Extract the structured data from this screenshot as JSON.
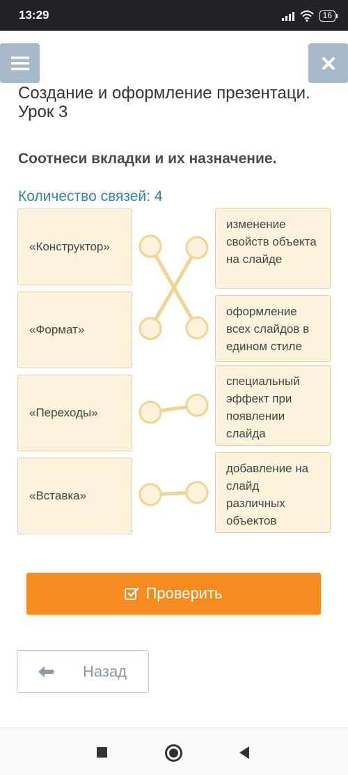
{
  "status": {
    "time": "13:29",
    "battery": "16"
  },
  "header": {
    "menu_icon": "hamburger-icon",
    "close_icon": "close-icon"
  },
  "lesson": {
    "title": "Создание и оформление презентаци. Урок 3"
  },
  "task": {
    "title": "Соотнеси вкладки и их назначение.",
    "links_count": "Количество связей: 4"
  },
  "matching": {
    "left": [
      "«Конструктор»",
      "«Формат»",
      "«Переходы»",
      "«Вставка»"
    ],
    "right": [
      "изменение свойств объекта на слайде",
      "оформление всех слайдов в едином стиле",
      "специальный эффект при появлении слайда",
      "добавление на слайд различных объектов"
    ],
    "links": [
      [
        0,
        1
      ],
      [
        1,
        0
      ],
      [
        2,
        2
      ],
      [
        3,
        3
      ]
    ],
    "connector_color": "#f0d58e"
  },
  "buttons": {
    "check_label": "Проверить",
    "back_label": "Назад"
  },
  "colors": {
    "accent": "#f68b1f",
    "link_text": "#2e86b5",
    "card_bg": "#fdf2dc"
  }
}
